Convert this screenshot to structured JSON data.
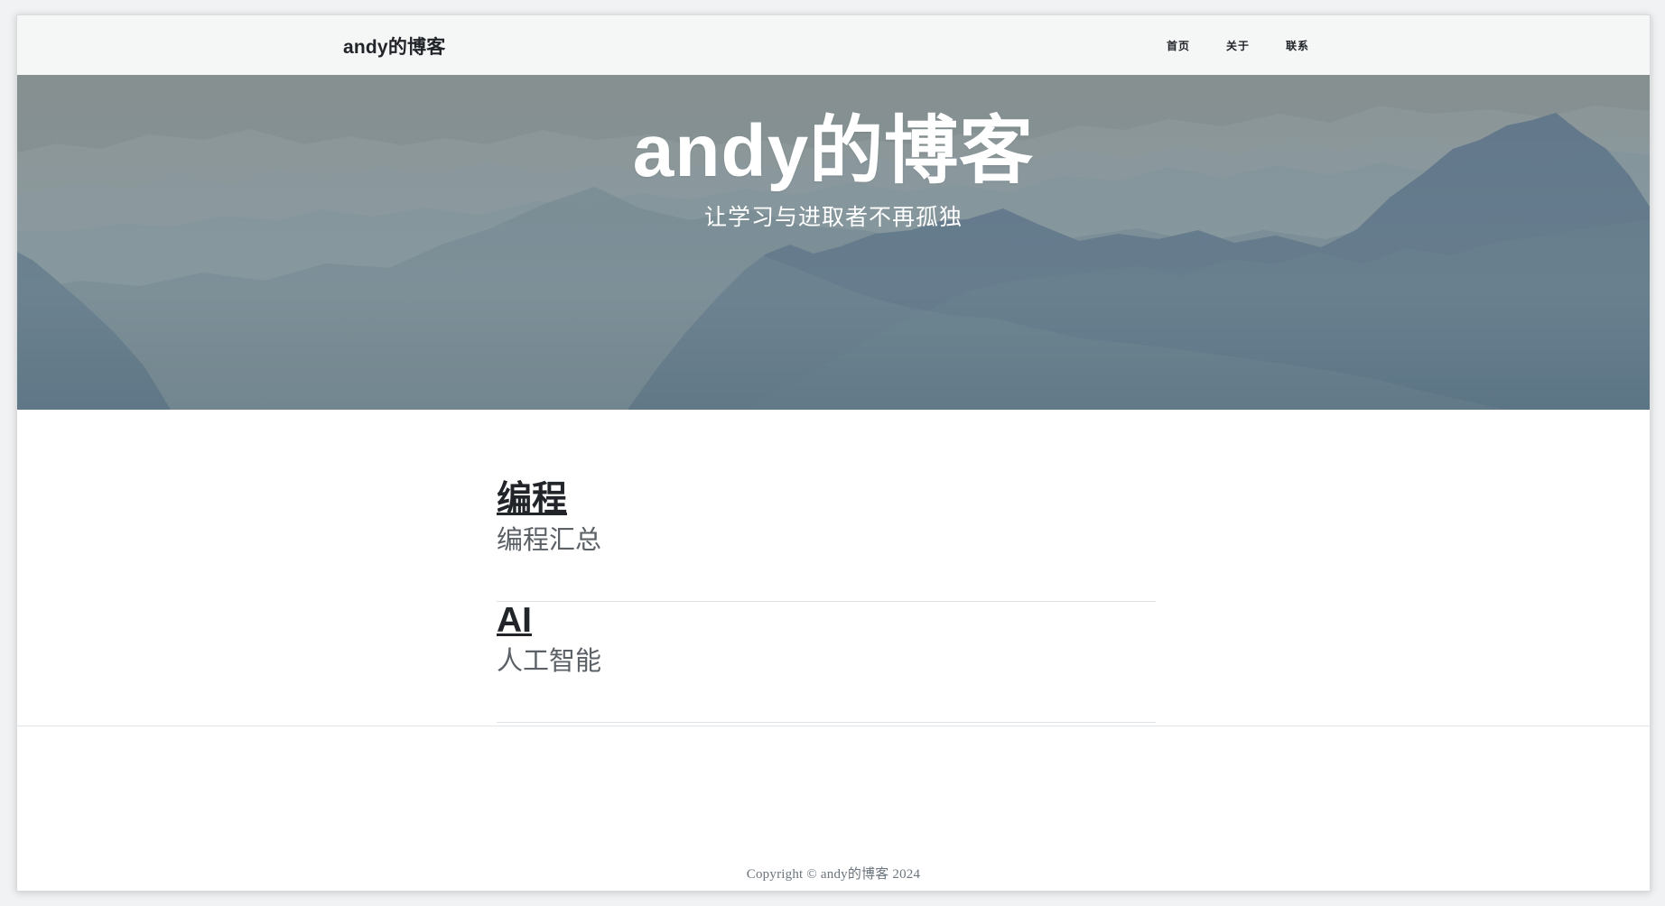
{
  "header": {
    "brand": "andy的博客",
    "nav": [
      {
        "label": "首页"
      },
      {
        "label": "关于"
      },
      {
        "label": "联系"
      }
    ]
  },
  "hero": {
    "title": "andy的博客",
    "subtitle": "让学习与进取者不再孤独",
    "background_icon": "mountain-landscape-image"
  },
  "posts": [
    {
      "title": "编程",
      "subtitle": "编程汇总"
    },
    {
      "title": "AI",
      "subtitle": "人工智能"
    }
  ],
  "footer": {
    "copyright": "Copyright © andy的博客 2024"
  },
  "colors": {
    "page_background": "#f1f2f3",
    "content_background": "#ffffff",
    "navbar_background": "#f5f6f6",
    "text_primary": "#212529",
    "text_secondary": "#5b6167",
    "text_muted": "#6c757d",
    "hero_overlay": "#73848a"
  }
}
